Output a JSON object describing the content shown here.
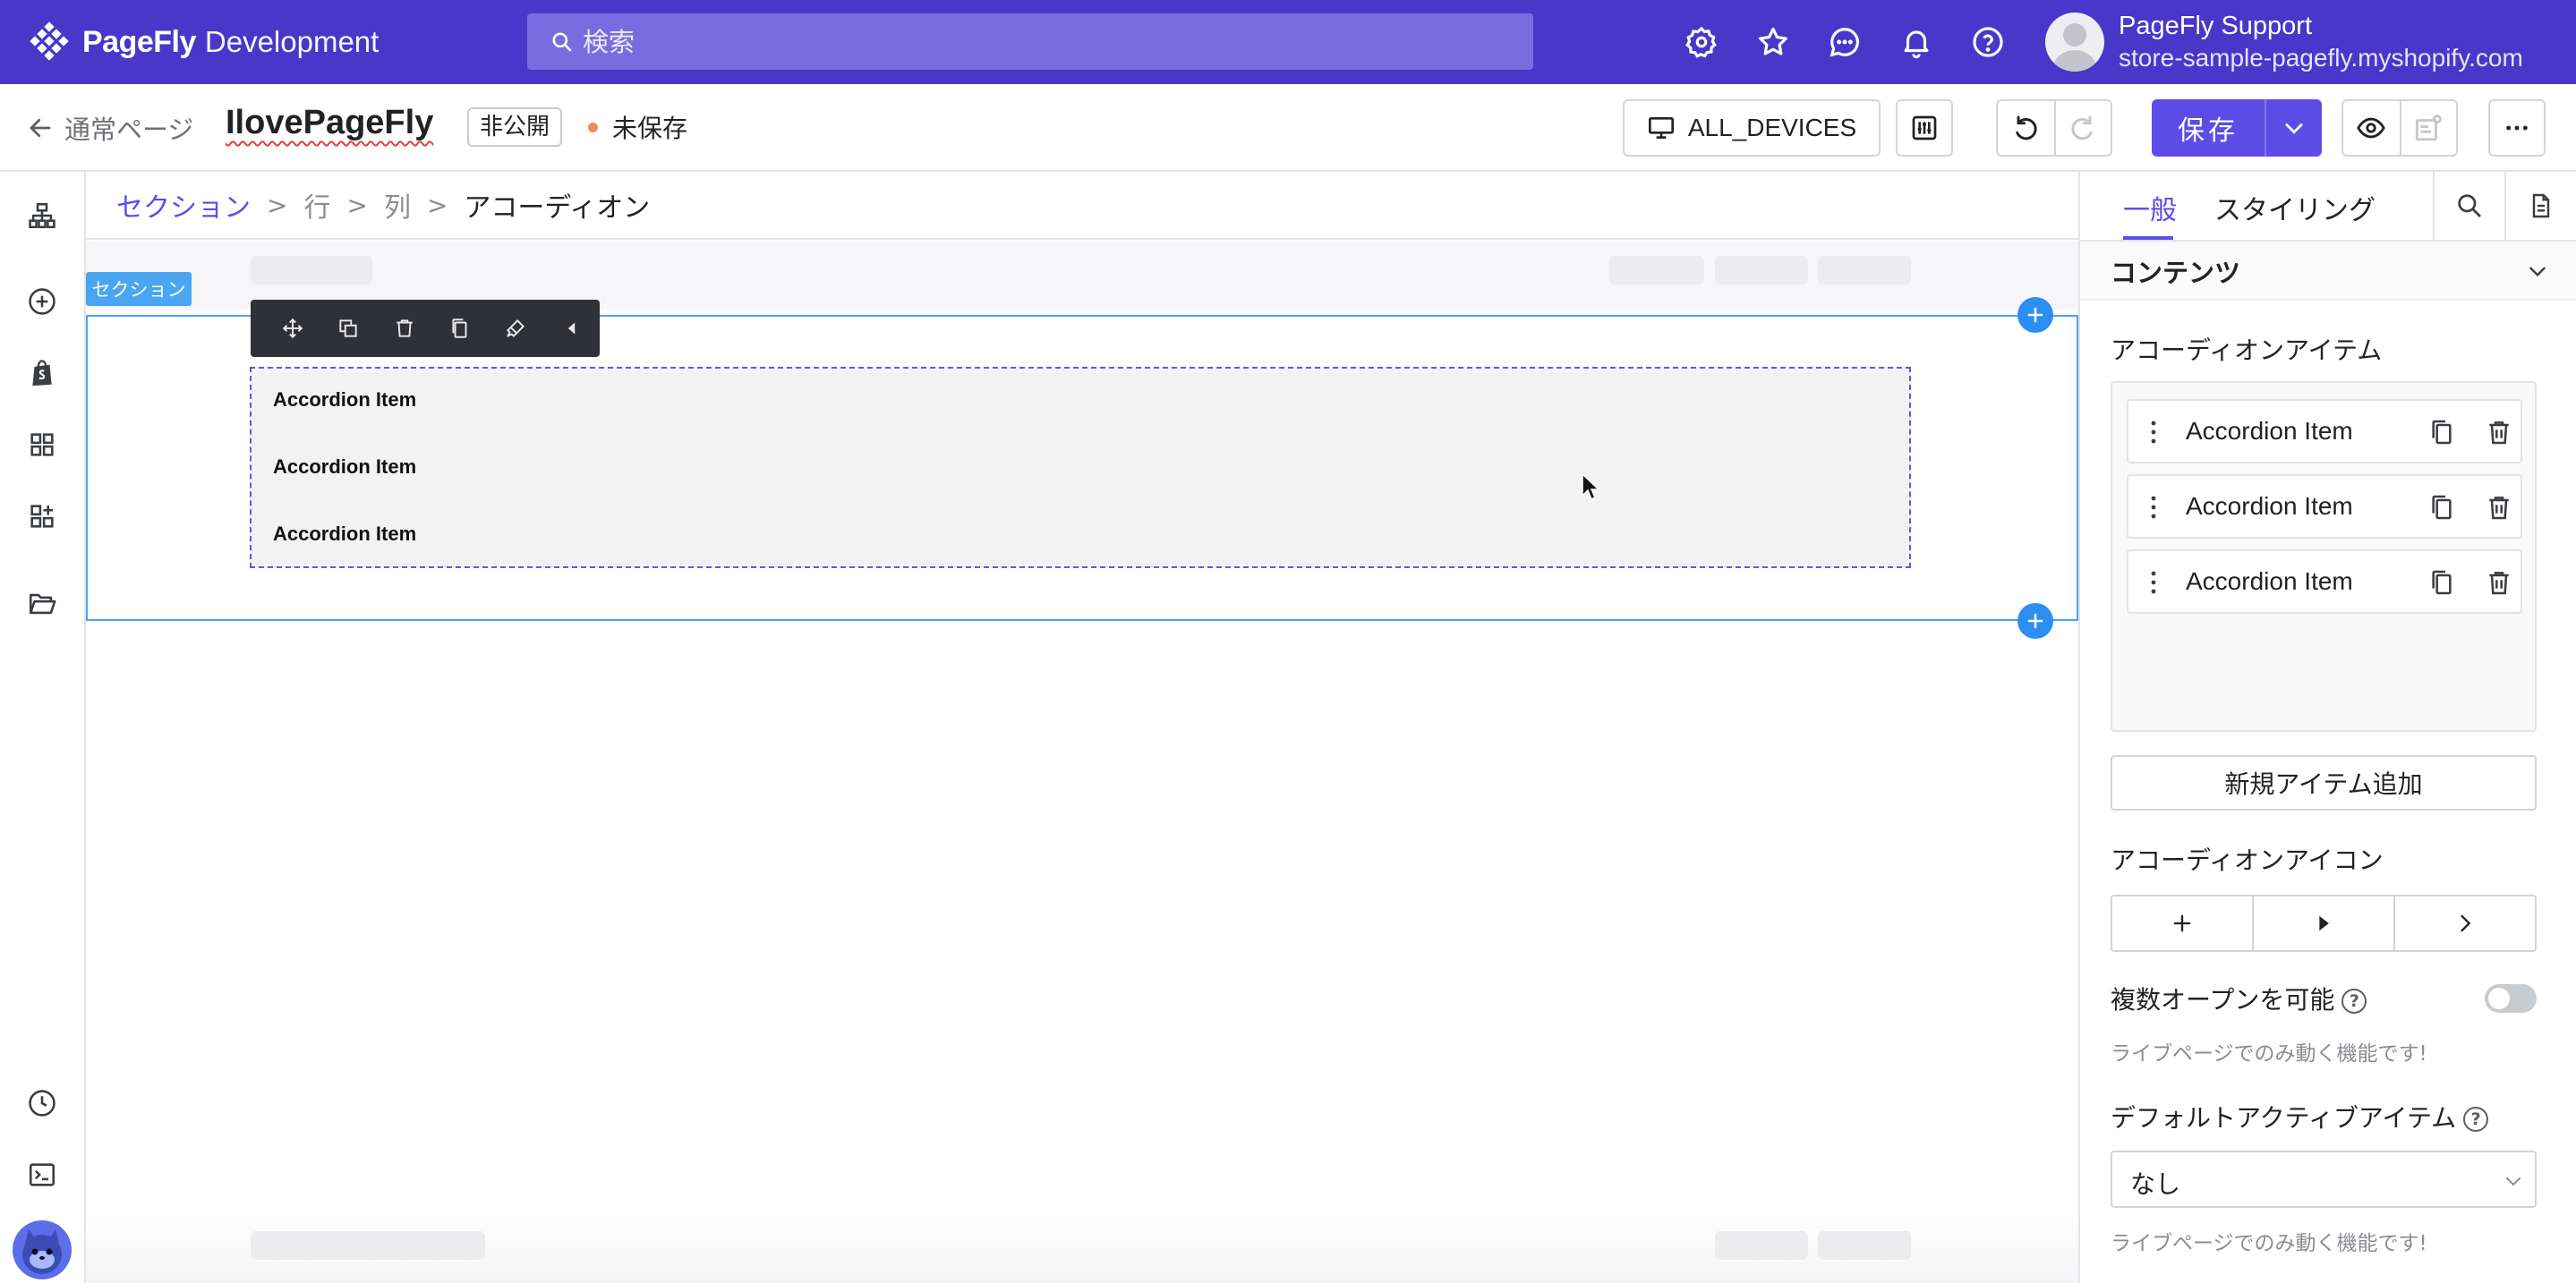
{
  "topbar": {
    "brand_name": "PageFly",
    "brand_env": "Development",
    "search_placeholder": "検索",
    "icons": [
      "settings-icon",
      "star-icon",
      "chat-icon",
      "bell-icon",
      "help-icon"
    ],
    "account_name": "PageFly Support",
    "account_store": "store-sample-pagefly.myshopify.com"
  },
  "header": {
    "back_label": "通常ページ",
    "page_name": "IlovePageFly",
    "status": "非公開",
    "save_state": "未保存",
    "device_label": "ALL_DEVICES",
    "save_label": "保存"
  },
  "leftrail": {
    "icons": [
      "sitemap-icon",
      "add-circle-icon",
      "shopify-icon",
      "grid-icon",
      "apps-add-icon",
      "folder-icon",
      "history-icon",
      "terminal-icon"
    ]
  },
  "canvas": {
    "breadcrumb": [
      "セクション",
      "行",
      "列",
      "アコーディオン"
    ],
    "section_tag": "セクション",
    "toolbar_icons": [
      "move-icon",
      "duplicate-icon",
      "delete-icon",
      "copy-icon",
      "style-brush-icon",
      "collapse-icon"
    ],
    "accordion_items": [
      "Accordion Item",
      "Accordion Item",
      "Accordion Item"
    ]
  },
  "panel": {
    "tab_general": "一般",
    "tab_styling": "スタイリング",
    "content_title": "コンテンツ",
    "items_label": "アコーディオンアイテム",
    "items": [
      "Accordion Item",
      "Accordion Item",
      "Accordion Item"
    ],
    "add_item": "新規アイテム追加",
    "icon_label": "アコーディオンアイコン",
    "icon_options": [
      "plus-icon",
      "triangle-right-icon",
      "chevron-right-icon"
    ],
    "multi_open_label": "複数オープンを可能",
    "multi_open_enabled": false,
    "live_only_hint": "ライブページでのみ動く機能です!",
    "default_active_label": "デフォルトアクティブアイテム",
    "default_active_value": "なし",
    "live_only_hint_2": "ライブページでのみ動く機能です!"
  },
  "colors": {
    "topbar": "#4a36c9",
    "accent": "#5b4de6",
    "selection": "#4aa5f2",
    "add_dot": "#2b8ef3"
  }
}
